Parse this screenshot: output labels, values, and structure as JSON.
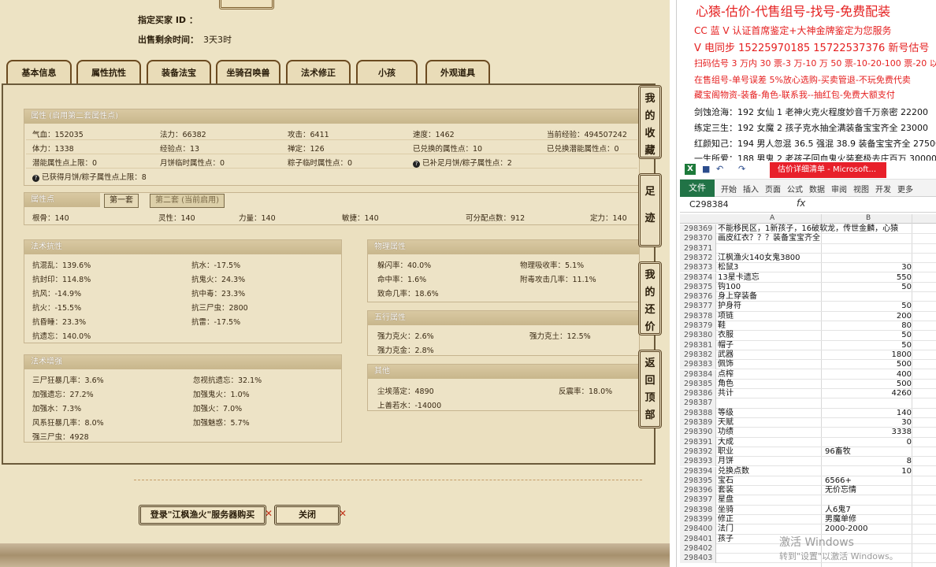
{
  "game": {
    "header": {
      "buyer_id_label": "指定买家 ID ：",
      "time_left_label": "出售剩余时间：",
      "time_left_value": "3天3时"
    },
    "tabs": [
      "基本信息",
      "属性抗性",
      "装备法宝",
      "坐骑召唤兽",
      "法术修正",
      "小孩",
      "外观道具"
    ],
    "attr_box": {
      "title": "属性 (启用第二套属性点)",
      "rows": [
        [
          "气血：152035",
          "法力：66382",
          "攻击：6411",
          "速度：1462",
          "当前经验：494507242"
        ],
        [
          "体力：1338",
          "经验点：13",
          "禅定：126",
          "已兑换的属性点：10",
          "已兑换潜能属性点：0"
        ],
        [
          "潜能属性点上限：0",
          "月饼临时属性点：0",
          "粽子临时属性点：0",
          "已补足月饼/粽子属性点：2"
        ]
      ],
      "last_line": "已获得月饼/粽子属性点上限：8"
    },
    "points_box": {
      "title": "属性点",
      "subtab1": "第一套",
      "subtab2": "第二套 (当前启用)",
      "values": [
        "根骨：140",
        "灵性：140",
        "力量：140",
        "敏捷：140",
        "可分配点数：912",
        "定力：140"
      ]
    },
    "resist_box": {
      "title": "法术抗性",
      "left": [
        "抗混乱：139.6%",
        "抗封印：114.8%",
        "抗风：-14.9%",
        "抗火：-15.5%",
        "抗昏睡：23.3%",
        "抗遗忘：140.0%"
      ],
      "right": [
        "抗水：-17.5%",
        "抗鬼火：24.3%",
        "抗中毒：23.3%",
        "抗三尸虫：2800",
        "抗雷：-17.5%"
      ]
    },
    "enhance_box": {
      "title": "法术增强",
      "left": [
        "三尸狂暴几率：3.6%",
        "加强遗忘：27.2%",
        "加强水：7.3%",
        "风系狂暴几率：8.0%",
        "强三尸虫：4928"
      ],
      "right": [
        "忽视抗遗忘：32.1%",
        "加强鬼火：1.0%",
        "加强火：7.0%",
        "加强魅惑：5.7%"
      ]
    },
    "physical_box": {
      "title": "物理属性",
      "left": [
        "躲闪率：40.0%",
        "命中率：1.6%",
        "致命几率：18.6%"
      ],
      "right": [
        "物理吸收率：5.1%",
        "附毒攻击几率：11.1%"
      ]
    },
    "five_box": {
      "title": "五行属性",
      "items": [
        "强力克火：2.6%",
        "强力克土：12.5%",
        "强力克金：2.8%"
      ]
    },
    "other_box": {
      "title": "其他",
      "items": [
        "尘埃落定：4890",
        "反震率：18.0%",
        "上善若水：-14000"
      ]
    },
    "side_buttons": [
      "我的收藏",
      "足迹",
      "我的还价",
      "返回顶部"
    ],
    "login_button": "登录\"江枫渔火\"服务器购买",
    "close_button": "关闭"
  },
  "right": {
    "ads": [
      "心猿-估价-代售组号-找号-免费配装",
      "CC 蓝 V 认证首席鉴定+大神金牌鉴定为您服务",
      "V 电同步 15225970185 15722537376 新号估号",
      "扫码估号 3 万内 30 票-3 万-10 万 50 票-10-20-100 票-20 以上 150",
      "在售组号-单号误差 5%放心选购-买卖管退-不玩免费代卖",
      "藏宝阁物资-装备-角色-联系我--抽红包-免费大额支付",
      "剑蚀沧海：192 女仙 1 老神火克火程度妙音千万亲密 22200",
      "练定三生：192 女魔 2 孩子克水抽全满装备宝宝齐全 23000",
      "红颜知己：194 男人忽混 36.5 强混 38.9 装备宝宝齐全 27500",
      "一生所爱：188 男鬼 2 老孩子回血鬼火装套极去庄百万 30000"
    ],
    "excel": {
      "logo": "X",
      "title": "估价详细清单 - Microsoft...",
      "ribbon": [
        "文件",
        "开始",
        "插入",
        "页面",
        "公式",
        "数据",
        "审阅",
        "视图",
        "开发",
        "更多"
      ],
      "name_box": "C298384",
      "fx": "fx",
      "col_a": "A",
      "col_b": "B",
      "rows": [
        {
          "n": "298369",
          "a": "不能移民区，1新孩子，16破软龙，传世金麟，心猿",
          "b": "",
          "num": false
        },
        {
          "n": "298370",
          "a": "画皮红衣？？？装备宝宝齐全",
          "b": "",
          "num": false
        },
        {
          "n": "298371",
          "a": "",
          "b": "",
          "num": false
        },
        {
          "n": "298372",
          "a": "江枫渔火140女鬼3800",
          "b": "",
          "num": false
        },
        {
          "n": "298373",
          "a": "松鼠3",
          "b": "30",
          "num": true
        },
        {
          "n": "298374",
          "a": "13星卡遗忘",
          "b": "550",
          "num": true
        },
        {
          "n": "298375",
          "a": "钩100",
          "b": "50",
          "num": true
        },
        {
          "n": "298376",
          "a": "身上穿装备",
          "b": "",
          "num": false
        },
        {
          "n": "298377",
          "a": "护身符",
          "b": "50",
          "num": true
        },
        {
          "n": "298378",
          "a": "项链",
          "b": "200",
          "num": true
        },
        {
          "n": "298379",
          "a": "鞋",
          "b": "80",
          "num": true
        },
        {
          "n": "298380",
          "a": "衣服",
          "b": "50",
          "num": true
        },
        {
          "n": "298381",
          "a": "帽子",
          "b": "50",
          "num": true
        },
        {
          "n": "298382",
          "a": "武器",
          "b": "1800",
          "num": true
        },
        {
          "n": "298383",
          "a": "佩饰",
          "b": "500",
          "num": true
        },
        {
          "n": "298384",
          "a": "点榨",
          "b": "400",
          "num": true
        },
        {
          "n": "298385",
          "a": "角色",
          "b": "500",
          "num": true
        },
        {
          "n": "298386",
          "a": "共计",
          "b": "4260",
          "num": true
        },
        {
          "n": "298387",
          "a": "",
          "b": "",
          "num": false
        },
        {
          "n": "298388",
          "a": "等级",
          "b": "140",
          "num": true
        },
        {
          "n": "298389",
          "a": "天赋",
          "b": "30",
          "num": true
        },
        {
          "n": "298390",
          "a": "功绩",
          "b": "3338",
          "num": true
        },
        {
          "n": "298391",
          "a": "大成",
          "b": "0",
          "num": true
        },
        {
          "n": "298392",
          "a": "职业",
          "b": "96畜牧",
          "num": false
        },
        {
          "n": "298393",
          "a": "月饼",
          "b": "8",
          "num": true
        },
        {
          "n": "298394",
          "a": "兑换点数",
          "b": "10",
          "num": true
        },
        {
          "n": "298395",
          "a": "宝石",
          "b": "6566+",
          "num": false
        },
        {
          "n": "298396",
          "a": "套装",
          "b": "无价忘情",
          "num": false
        },
        {
          "n": "298397",
          "a": "星盘",
          "b": "",
          "num": false
        },
        {
          "n": "298398",
          "a": "坐骑",
          "b": "人6鬼7",
          "num": false
        },
        {
          "n": "298399",
          "a": "修正",
          "b": "男魔单修",
          "num": false
        },
        {
          "n": "298400",
          "a": "法门",
          "b": "2000-2000",
          "num": false
        },
        {
          "n": "298401",
          "a": "孩子",
          "b": "",
          "num": false
        },
        {
          "n": "298402",
          "a": "",
          "b": "",
          "num": false
        },
        {
          "n": "298403",
          "a": "",
          "b": "",
          "num": false
        }
      ]
    },
    "watermark_1": "激活 Windows",
    "watermark_2": "转到\"设置\"以激活 Windows。"
  }
}
